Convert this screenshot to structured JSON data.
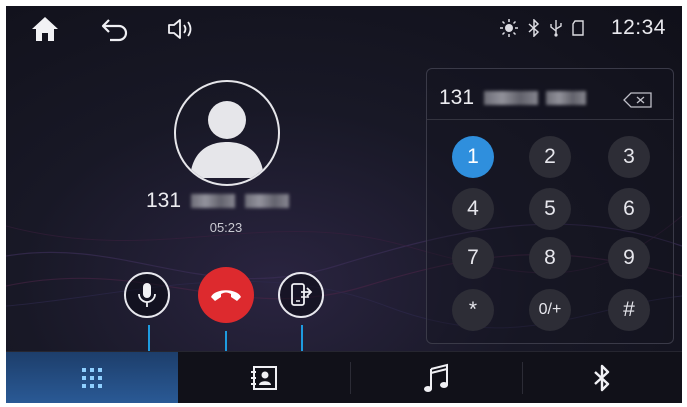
{
  "status_bar": {
    "home_icon": "home-icon",
    "back_icon": "back-arrow-icon",
    "volume_icon": "speaker-icon",
    "indicators": [
      "brightness-icon",
      "bluetooth-icon",
      "usb-icon",
      "sd-card-icon"
    ],
    "time": "12:34"
  },
  "call": {
    "avatar_icon": "person-icon",
    "number_prefix": "131",
    "duration": "05:23"
  },
  "controls": [
    {
      "name": "mute-microphone-button",
      "icon": "microphone-icon"
    },
    {
      "name": "hang-up-button",
      "icon": "phone-hangup-icon",
      "color": "#dd2a2e"
    },
    {
      "name": "switch-to-phone-button",
      "icon": "phone-transfer-icon"
    }
  ],
  "dialpad": {
    "display_prefix": "131",
    "backspace_icon": "backspace-icon",
    "keys": [
      "1",
      "2",
      "3",
      "4",
      "5",
      "6",
      "7",
      "8",
      "9",
      "*",
      "0/+",
      "#"
    ],
    "active_key": "1",
    "accent_color": "#2f8fdd"
  },
  "tabs": [
    {
      "icon": "dialpad-grid-icon",
      "active": true
    },
    {
      "icon": "contacts-icon",
      "active": false
    },
    {
      "icon": "music-note-icon",
      "active": false
    },
    {
      "icon": "bluetooth-icon",
      "active": false
    }
  ],
  "callout_color": "#1e9be0"
}
